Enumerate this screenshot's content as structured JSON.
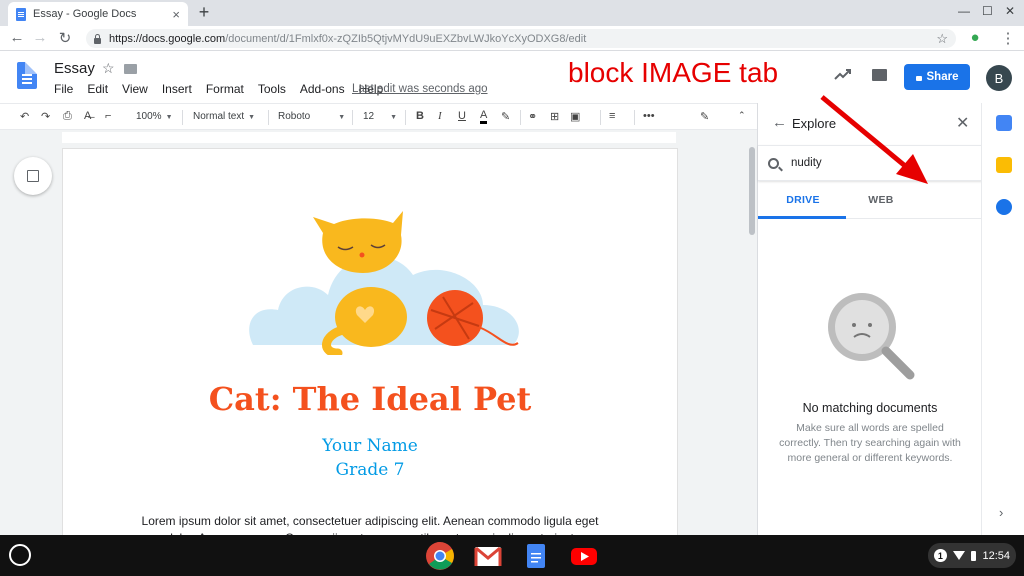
{
  "browser": {
    "tab_title": "Essay - Google Docs",
    "tab_close": "×",
    "new_tab": "+",
    "url_host": "https://docs.google.com",
    "url_path": "/document/d/1Fmlxf0x-zQZIb5QtjvMYdU9uEXZbvLWJkoYcXyODXG8/edit"
  },
  "docs": {
    "title": "Essay",
    "menu": [
      "File",
      "Edit",
      "View",
      "Insert",
      "Format",
      "Tools",
      "Add-ons",
      "Help"
    ],
    "last_edit": "Last edit was seconds ago",
    "share_label": "Share",
    "avatar_initial": "B"
  },
  "annotation": {
    "text": "block IMAGE tab",
    "color": "#e60000"
  },
  "toolbar": {
    "zoom": "100%",
    "style": "Normal text",
    "font": "Roboto",
    "size": "12",
    "bold": "B",
    "italic": "I",
    "underline": "U",
    "text_color": "A",
    "more": "•••"
  },
  "document": {
    "heading": "Cat: The Ideal Pet",
    "name_line": "Your Name",
    "grade_line": "Grade 7",
    "body": "Lorem ipsum dolor sit amet, consectetuer adipiscing elit. Aenean commodo ligula eget dolor. Aenean massa. Cum sociis natoque penatibus et magnis dis parturient"
  },
  "explore": {
    "title": "Explore",
    "search_value": "nudity",
    "tabs": [
      "DRIVE",
      "WEB"
    ],
    "active_tab": "DRIVE",
    "empty_title": "No matching documents",
    "empty_desc": "Make sure all words are spelled correctly. Then try searching again with more general or different keywords."
  },
  "shelf": {
    "notification_count": "1",
    "clock": "12:54"
  },
  "colors": {
    "accent": "#1a73e8",
    "heading": "#f4511e",
    "subheading": "#039be5"
  }
}
